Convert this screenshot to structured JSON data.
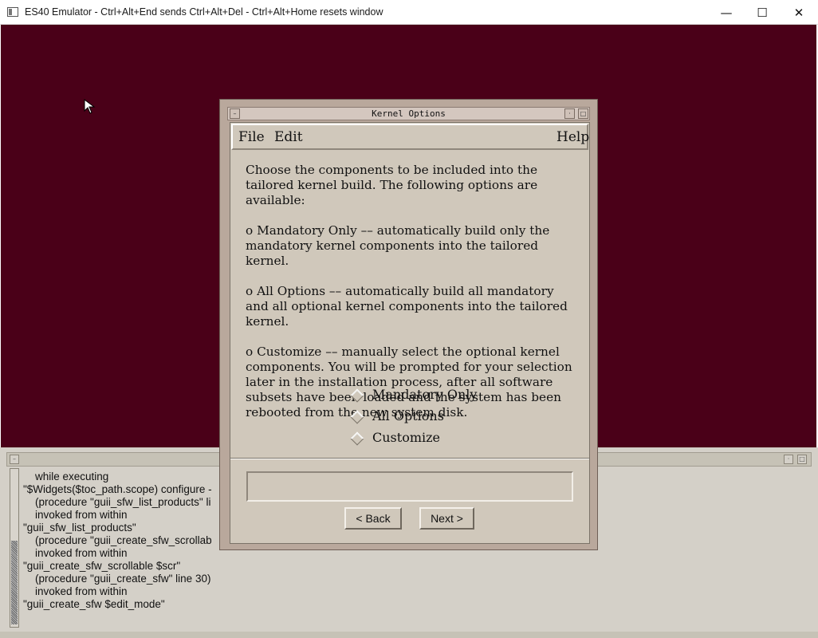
{
  "window": {
    "title": "ES40 Emulator - Ctrl+Alt+End sends Ctrl+Alt+Del - Ctrl+Alt+Home resets window",
    "minimize_glyph": "—",
    "maximize_glyph": "☐",
    "close_glyph": "✕"
  },
  "console": {
    "lines": [
      "    while executing",
      "\"$Widgets($toc_path.scope) configure -",
      "    (procedure \"guii_sfw_list_products\" li",
      "    invoked from within",
      "\"guii_sfw_list_products\"",
      "    (procedure \"guii_create_sfw_scrollab",
      "    invoked from within",
      "\"guii_create_sfw_scrollable $scr\"",
      "    (procedure \"guii_create_sfw\" line 30)",
      "    invoked from within",
      "\"guii_create_sfw $edit_mode\""
    ]
  },
  "dialog": {
    "title": "Kernel Options",
    "menu": {
      "file": "File",
      "edit": "Edit",
      "help": "Help"
    },
    "paragraphs": [
      "Choose the components to be included into the tailored kernel build.  The following options are available:",
      "o  Mandatory Only –– automatically build only the mandatory kernel components into the tailored kernel.",
      "o  All Options –– automatically build all mandatory and all optional kernel components into the tailored kernel.",
      "o  Customize –– manually select the optional kernel components. You will be prompted for your selection later in the installation process, after all software subsets have been loaded and the system has been rebooted from the new system disk."
    ],
    "options": [
      "Mandatory Only",
      "All Options",
      "Customize"
    ],
    "status_text": "",
    "buttons": {
      "back": "< Back",
      "next": "Next >"
    }
  },
  "colors": {
    "desktop": "#4a0018",
    "dialog_frame": "#b9a89c",
    "dialog_body": "#d0c8bb",
    "console_bg": "#d4d0c8"
  },
  "icons": [
    "app-icon",
    "mouse-cursor-icon",
    "radio-diamond-icon"
  ]
}
